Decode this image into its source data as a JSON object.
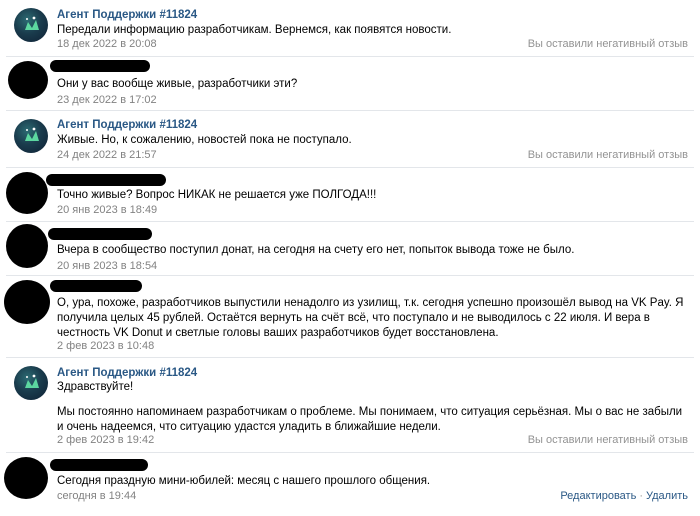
{
  "messages": [
    {
      "author": "Агент Поддержки #11824",
      "text": "Передали информацию разработчикам. Вернемся, как появятся новости.",
      "time": "18 дек 2022 в 20:08",
      "feedback": "Вы оставили негативный отзыв"
    },
    {
      "text": "Они у вас вообще живые, разработчики эти?",
      "time": "23 дек 2022 в 17:02"
    },
    {
      "author": "Агент Поддержки #11824",
      "text": "Живые. Но, к сожалению, новостей пока не поступало.",
      "time": "24 дек 2022 в 21:57",
      "feedback": "Вы оставили негативный отзыв"
    },
    {
      "text": "Точно живые? Вопрос НИКАК не решается уже ПОЛГОДА!!!",
      "time": "20 янв 2023 в 18:49"
    },
    {
      "text": "Вчера в сообщество поступил донат, на сегодня на счету его нет, попыток вывода тоже не было.",
      "time": "20 янв 2023 в 18:54"
    },
    {
      "text": "О, ура, похоже, разработчиков выпустили ненадолго из узилищ, т.к. сегодня успешно произошёл вывод на VK Pay. Я получила целых 45 рублей. Остаётся вернуть на счёт всё, что поступало и не выводилось с 22 июля. И вера в честность VK Donut и светлые головы ваших разработчиков будет восстановлена.",
      "time": "2 фев 2023 в 10:48"
    },
    {
      "author": "Агент Поддержки #11824",
      "greeting": "Здравствуйте!",
      "text": "Мы постоянно напоминаем разработчикам о проблеме. Мы понимаем, что ситуация серьёзная. Мы о вас не забыли и очень надеемся, что ситуацию удастся уладить в ближайшие недели.",
      "time": "2 фев 2023 в 19:42",
      "feedback": "Вы оставили негативный отзыв"
    },
    {
      "text": "Сегодня праздную мини-юбилей: месяц с нашего прошлого общения.",
      "time": "сегодня в 19:44",
      "edit_label": "Редактировать",
      "delete_label": "Удалить"
    }
  ]
}
